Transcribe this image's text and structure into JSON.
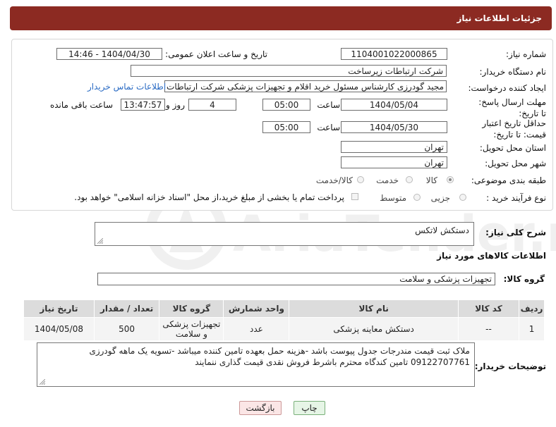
{
  "header": {
    "title": "جزئیات اطلاعات نیاز"
  },
  "form": {
    "need_number_label": "شماره نیاز:",
    "need_number": "1104001022000865",
    "announce_label": "تاریخ و ساعت اعلان عمومی:",
    "announce_value": "1404/04/30 - 14:46",
    "buyer_org_label": "نام دستگاه خریدار:",
    "buyer_org": "شرکت ارتباطات زیرساخت",
    "creator_label": "ایجاد کننده درخواست:",
    "creator": "مجید گودرزی کارشناس مسئول خرید اقلام و تجهیزات پزشکی شرکت ارتباطات ز",
    "contact_link": "اطلاعات تماس خریدار",
    "deadline_label": "مهلت ارسال پاسخ: تا تاریخ:",
    "deadline_date": "1404/05/04",
    "time_label": "ساعت",
    "deadline_time": "05:00",
    "days_value": "4",
    "days_label": "روز و",
    "remaining_time": "13:47:57",
    "remaining_label": "ساعت باقی مانده",
    "min_validity_label": "حداقل تاریخ اعتبار قیمت: تا تاریخ:",
    "validity_date": "1404/05/30",
    "validity_time": "05:00",
    "province_label": "استان محل تحویل:",
    "province": "تهران",
    "city_label": "شهر محل تحویل:",
    "city": "تهران",
    "category_label": "طبقه بندی موضوعی:",
    "category_options": [
      "کالا",
      "خدمت",
      "کالا/خدمت"
    ],
    "process_label": "نوع فرآیند خرید :",
    "process_options": [
      "جزیی",
      "متوسط"
    ],
    "payment_note": "پرداخت تمام یا بخشی از مبلغ خرید،از محل \"اسناد خزانه اسلامی\" خواهد بود."
  },
  "description": {
    "label": "شرح کلی نیاز:",
    "value": "دستکش لاتکس"
  },
  "goods_section": {
    "title": "اطلاعات کالاهای مورد نیاز",
    "group_label": "گروه کالا:",
    "group_value": "تجهیزات پزشکی و سلامت"
  },
  "table": {
    "headers": [
      "ردیف",
      "کد کالا",
      "نام کالا",
      "واحد شمارش",
      "گروه کالا",
      "تعداد / مقدار",
      "تاریخ نیاز"
    ],
    "rows": [
      [
        "1",
        "--",
        "دستکش معاینه پزشکی",
        "عدد",
        "تجهیزات پزشکی و سلامت",
        "500",
        "1404/05/08"
      ]
    ]
  },
  "buyer_notes": {
    "label": "توضیحات خریدار:",
    "value": "ملاک ثبت قیمت مندرجات جدول پیوست باشد -هزینه حمل بعهده تامین کننده میباشد -تسویه یک ماهه گودرزی 09122707761 تامین کندگاه محترم باشرط فروش  نقدی قیمت گذاری ننمایند"
  },
  "buttons": {
    "print": "چاپ",
    "back": "بازگشت"
  },
  "watermark": {
    "text": "AriaTender.net"
  },
  "colors": {
    "header": "#8c2a22",
    "link": "#2a6bc4",
    "print_btn": "#e6f5e6",
    "back_btn": "#fbe6e6"
  }
}
